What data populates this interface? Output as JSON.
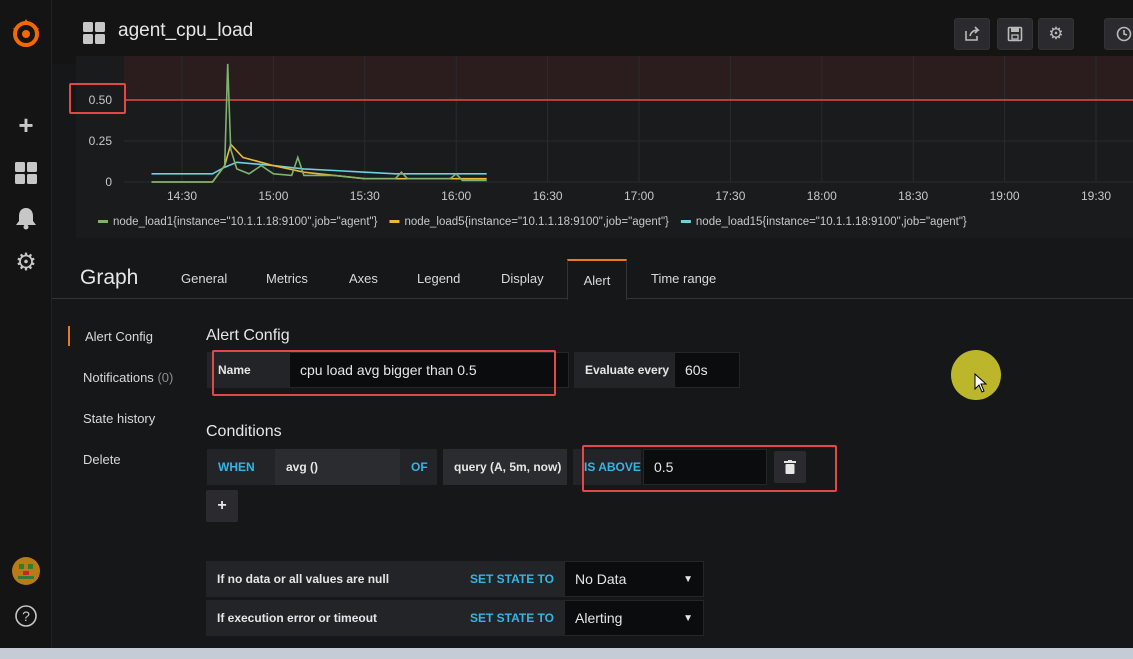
{
  "header": {
    "title": "agent_cpu_load"
  },
  "chart_data": {
    "type": "line",
    "y_tick_labels": [
      "0.50",
      "0.25",
      "0"
    ],
    "x_tick_labels": [
      "14:30",
      "15:00",
      "15:30",
      "16:00",
      "16:30",
      "17:00",
      "17:30",
      "18:00",
      "18:30",
      "19:00",
      "19:30"
    ],
    "ylim": [
      0,
      0.75
    ],
    "threshold": 0.5,
    "series": [
      {
        "name": "node_load1{instance=\"10.1.1.18:9100\",job=\"agent\"}",
        "color": "#7eb26d",
        "x": [
          "14:20",
          "14:40",
          "14:44",
          "14:45",
          "14:46",
          "14:48",
          "14:52",
          "14:56",
          "15:00",
          "15:06",
          "15:08",
          "15:10",
          "15:20",
          "15:30",
          "15:40",
          "15:42",
          "15:44",
          "15:50",
          "15:58",
          "16:00",
          "16:02",
          "16:10"
        ],
        "values": [
          0.0,
          0.0,
          0.1,
          0.72,
          0.2,
          0.08,
          0.05,
          0.1,
          0.05,
          0.04,
          0.15,
          0.04,
          0.04,
          0.02,
          0.02,
          0.06,
          0.02,
          0.02,
          0.02,
          0.05,
          0.01,
          0.01
        ]
      },
      {
        "name": "node_load5{instance=\"10.1.1.18:9100\",job=\"agent\"}",
        "color": "#eab839",
        "x": [
          "14:20",
          "14:40",
          "14:44",
          "14:46",
          "14:50",
          "15:00",
          "15:10",
          "15:20",
          "15:30",
          "15:40",
          "15:50",
          "16:00",
          "16:10"
        ],
        "values": [
          0.0,
          0.0,
          0.1,
          0.23,
          0.15,
          0.1,
          0.06,
          0.04,
          0.02,
          0.02,
          0.02,
          0.02,
          0.02
        ]
      },
      {
        "name": "node_load15{instance=\"10.1.1.18:9100\",job=\"agent\"}",
        "color": "#6ed0e0",
        "x": [
          "14:20",
          "14:40",
          "14:44",
          "14:48",
          "15:00",
          "15:10",
          "15:20",
          "15:30",
          "15:40",
          "15:50",
          "16:00",
          "16:10"
        ],
        "values": [
          0.05,
          0.05,
          0.09,
          0.12,
          0.1,
          0.08,
          0.07,
          0.06,
          0.05,
          0.05,
          0.05,
          0.05
        ]
      }
    ]
  },
  "tabs": {
    "panel_title": "Graph",
    "general": "General",
    "metrics": "Metrics",
    "axes": "Axes",
    "legend": "Legend",
    "display": "Display",
    "alert": "Alert",
    "time_range": "Time range"
  },
  "side_menu": {
    "alert_config": "Alert Config",
    "notifications": "Notifications",
    "notifications_count": "(0)",
    "state_history": "State history",
    "delete": "Delete"
  },
  "alert_config": {
    "heading": "Alert Config",
    "name_label": "Name",
    "name_value": "cpu load avg bigger than 0.5",
    "evaluate_label": "Evaluate every",
    "evaluate_value": "60s"
  },
  "conditions": {
    "heading": "Conditions",
    "when": "WHEN",
    "reducer": "avg ()",
    "of": "OF",
    "query": "query (A, 5m, now)",
    "evaluator": "IS ABOVE",
    "threshold": "0.5",
    "add": "+"
  },
  "no_data": {
    "label": "If no data or all values are null",
    "set_state": "SET STATE TO",
    "value": "No Data"
  },
  "exec_error": {
    "label": "If execution error or timeout",
    "set_state": "SET STATE TO",
    "value": "Alerting"
  },
  "colors": {
    "accent": "#eb7b18",
    "keyword": "#33b5e5",
    "threshold_line": "#e24d42",
    "annotation_box": "#e34848"
  }
}
